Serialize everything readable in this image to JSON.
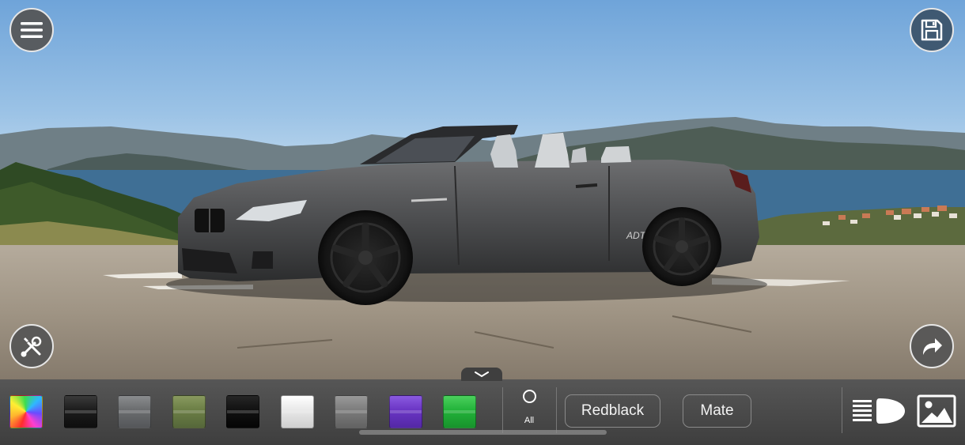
{
  "overlay": {
    "menu_icon": "hamburger-menu-icon",
    "save_icon": "floppy-save-icon",
    "tools_icon": "wrench-screwdriver-icon",
    "share_icon": "share-arrow-icon"
  },
  "car": {
    "badge": "ADT"
  },
  "toolbar": {
    "collapse_icon": "chevron-down-icon",
    "swatches": [
      {
        "name": "rainbow",
        "color": "multicolor"
      },
      {
        "name": "gloss-black",
        "color": "#1c1c1c"
      },
      {
        "name": "gunmetal-gray",
        "color": "#6a6c6e"
      },
      {
        "name": "olive-green",
        "color": "#6b7e45"
      },
      {
        "name": "matte-black",
        "color": "#111111"
      },
      {
        "name": "white",
        "color": "#e8e8e8"
      },
      {
        "name": "silver-gray",
        "color": "#7c7c7c"
      },
      {
        "name": "purple",
        "color": "#6a35c4"
      },
      {
        "name": "green",
        "color": "#22b33a"
      }
    ],
    "all_label": "All",
    "finish_buttons": [
      "Redblack",
      "Mate"
    ],
    "light_icon": "headlight-beam-icon",
    "background_icon": "landscape-image-icon"
  }
}
